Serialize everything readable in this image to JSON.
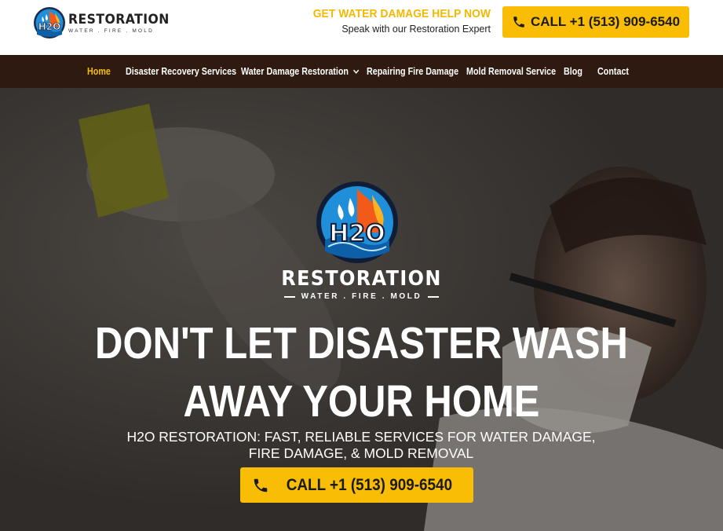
{
  "brand": {
    "name": "RESTORATION",
    "tagline": "WATER . FIRE . MOLD",
    "badge_text": "H2O"
  },
  "header": {
    "help_title": "GET WATER DAMAGE HELP NOW",
    "help_subtitle": "Speak with our Restoration Expert",
    "call_label": "CALL +1 (513) 909-6540",
    "call_icon": "phone-icon"
  },
  "nav": {
    "items": [
      {
        "label": "Home",
        "active": true
      },
      {
        "label": "Disaster Recovery Services"
      },
      {
        "label": "Water Damage Restoration",
        "has_dropdown": true
      },
      {
        "label": "Repairing Fire Damage"
      },
      {
        "label": "Mold Removal Service"
      },
      {
        "label": "Blog"
      },
      {
        "label": "Contact"
      }
    ]
  },
  "hero": {
    "brand_name": "RESTORATION",
    "brand_tagline": "WATER . FIRE . MOLD",
    "headline_line1": "DON'T LET DISASTER WASH",
    "headline_line2": "AWAY YOUR HOME",
    "subheadline": "H2O RESTORATION: FAST, RELIABLE SERVICES FOR WATER DAMAGE, FIRE DAMAGE, & MOLD REMOVAL",
    "call_label": "CALL +1 (513) 909-6540"
  },
  "colors": {
    "accent": "#f9bd06",
    "nav_bg": "#2e1a10",
    "help_title": "#f5b800",
    "text_dark": "#1b1b1b"
  }
}
